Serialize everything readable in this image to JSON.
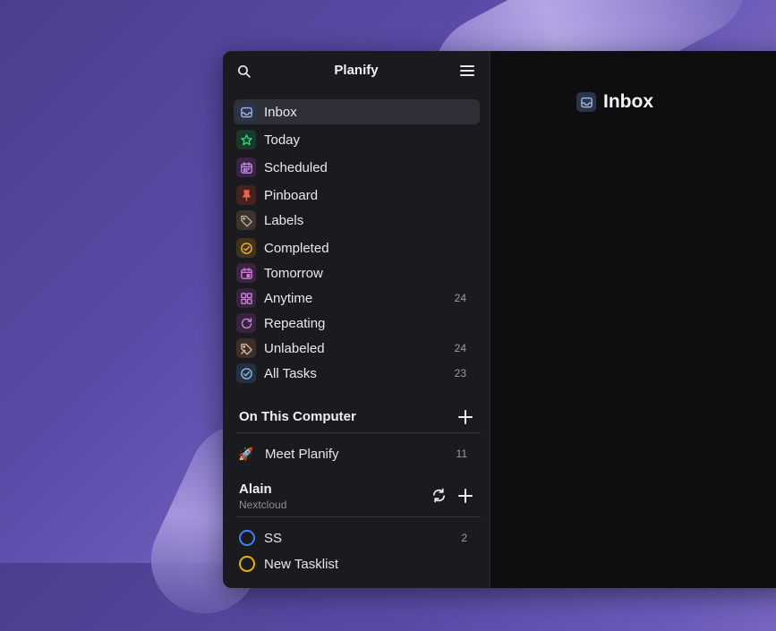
{
  "app": {
    "title": "Planify"
  },
  "nav": [
    {
      "label": "Inbox",
      "icon": "inbox-icon",
      "color": "#9fb8e6",
      "bg": "#2c3548",
      "active": true,
      "count": ""
    },
    {
      "label": "Today",
      "icon": "star-icon",
      "color": "#3fd27a",
      "bg": "#173a2a",
      "count": ""
    },
    {
      "label": "Scheduled",
      "icon": "calendar-icon",
      "color": "#c68ae8",
      "bg": "#3a2446",
      "count": ""
    },
    {
      "label": "Pinboard",
      "icon": "pin-icon",
      "color": "#f0604d",
      "bg": "#44221f",
      "count": ""
    },
    {
      "label": "Labels",
      "icon": "tag-icon",
      "color": "#b8a89a",
      "bg": "#3b332c",
      "count": ""
    },
    {
      "label": "Completed",
      "icon": "check-circle-icon",
      "color": "#f0b24a",
      "bg": "#41321a",
      "count": ""
    },
    {
      "label": "Tomorrow",
      "icon": "calendar-day-icon",
      "color": "#d37ed8",
      "bg": "#3d2340",
      "count": ""
    },
    {
      "label": "Anytime",
      "icon": "grid-icon",
      "color": "#c783d6",
      "bg": "#35243b",
      "count": "24"
    },
    {
      "label": "Repeating",
      "icon": "repeat-icon",
      "color": "#c78ae0",
      "bg": "#36243d",
      "count": ""
    },
    {
      "label": "Unlabeled",
      "icon": "tag-off-icon",
      "color": "#d2b49a",
      "bg": "#3b2f27",
      "count": "24"
    },
    {
      "label": "All Tasks",
      "icon": "check-all-icon",
      "color": "#8fb6ee",
      "bg": "#24303f",
      "count": "23"
    }
  ],
  "sections": {
    "local": {
      "title": "On This Computer",
      "projects": [
        {
          "label": "Meet Planify",
          "emoji": "🚀",
          "count": "11"
        }
      ]
    },
    "nextcloud": {
      "title": "Alain",
      "subtitle": "Nextcloud",
      "projects": [
        {
          "label": "SS",
          "ring": "#3b82f6",
          "count": "2"
        },
        {
          "label": "New Tasklist",
          "ring": "#eab308",
          "count": ""
        }
      ]
    }
  },
  "main": {
    "title": "Inbox",
    "icon": "inbox-icon"
  }
}
